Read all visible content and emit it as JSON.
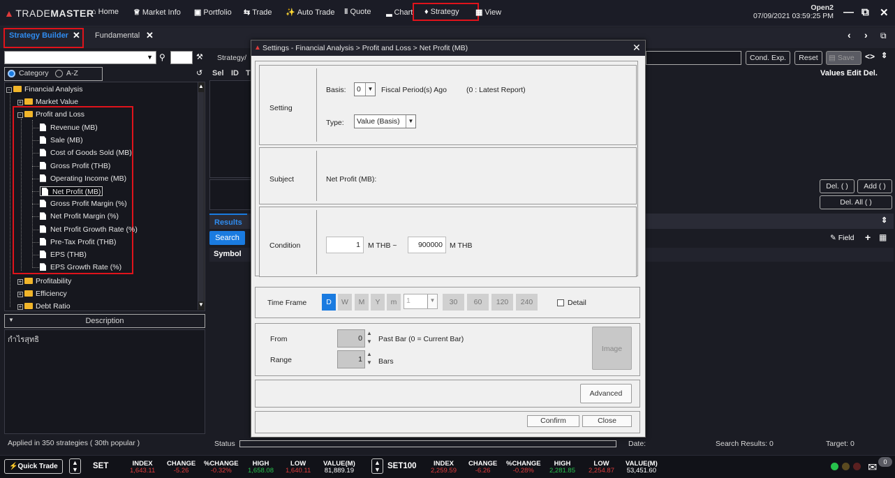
{
  "app": {
    "logo": "TRADEMASTER",
    "logo_brand": "TRADE",
    "logo_rest": "MASTER"
  },
  "menu": [
    {
      "label": "Home",
      "icon": "home-icon"
    },
    {
      "label": "Market Info",
      "icon": "bank-icon"
    },
    {
      "label": "Portfolio",
      "icon": "briefcase-icon"
    },
    {
      "label": "Trade",
      "icon": "trade-icon"
    },
    {
      "label": "Auto Trade",
      "icon": "auto-trade-icon"
    },
    {
      "label": "Quote",
      "icon": "quote-icon"
    },
    {
      "label": "Chart",
      "icon": "chart-icon"
    },
    {
      "label": "Strategy",
      "icon": "strategy-icon"
    },
    {
      "label": "View",
      "icon": "view-icon"
    }
  ],
  "account": {
    "name": "Open2",
    "datetime": "07/09/2021 03:59:25 PM"
  },
  "tabs": [
    {
      "label": "Strategy Builder",
      "active": true
    },
    {
      "label": "Fundamental",
      "active": false
    }
  ],
  "left": {
    "radio_category": "Category",
    "radio_az": "A-Z",
    "tree": {
      "financial_analysis": "Financial Analysis",
      "market_value": "Market Value",
      "profit_and_loss": "Profit and Loss",
      "pl_items": [
        "Revenue (MB)",
        "Sale (MB)",
        "Cost of Goods Sold (MB)",
        "Gross Profit (THB)",
        "Operating Income (MB)",
        "Net Profit (MB)",
        "Gross Profit Margin (%)",
        "Net Profit Margin (%)",
        "Net Profit Growth Rate (%)",
        "Pre-Tax Profit (THB)",
        "EPS (THB)",
        "EPS Growth Rate (%)"
      ],
      "selected_index": 5,
      "profitability": "Profitability",
      "efficiency": "Efficiency",
      "debt_ratio": "Debt Ratio"
    },
    "description_label": "Description",
    "description_text": "กำไรสุทธิ",
    "applied_text": "Applied in 350 strategies ( 30th popular )"
  },
  "main": {
    "strategy_label": "Strategy/",
    "cond_exp": "Cond. Exp.",
    "reset": "Reset",
    "save": "Save",
    "col_sel": "Sel",
    "col_id": "ID",
    "col_t": "T",
    "values_edit_del": "Values Edit  Del.",
    "del_paren": "Del. ( )",
    "add_paren": "Add ( )",
    "del_all": "Del. All ( )",
    "results": "Results",
    "search": "Search",
    "symbol": "Symbol",
    "field": "Field"
  },
  "status": {
    "status_label": "Status",
    "date_label": "Date:",
    "search_results": "Search Results:  0",
    "target": "Target:  0"
  },
  "dialog": {
    "title": "Settings - Financial Analysis > Profit and Loss > Net Profit (MB)",
    "setting_label": "Setting",
    "basis_label": "Basis:",
    "basis_value": "0",
    "fiscal_text": "Fiscal Period(s) Ago",
    "latest_text": "(0 : Latest Report)",
    "type_label": "Type:",
    "type_value": "Value (Basis)",
    "subject_label": "Subject",
    "subject_value": "Net Profit (MB):",
    "condition_label": "Condition",
    "cond_min": "1",
    "cond_unit1": "M THB ~",
    "cond_max": "900000",
    "cond_unit2": "M THB",
    "timeframe_label": "Time Frame",
    "tf_buttons": [
      "D",
      "W",
      "M",
      "Y",
      "m"
    ],
    "tf_combo": "1",
    "tf_minutes": [
      "30",
      "60",
      "120",
      "240"
    ],
    "detail_label": "Detail",
    "from_label": "From",
    "from_value": "0",
    "past_bar_text": "Past Bar (0 = Current Bar)",
    "range_label": "Range",
    "range_value": "1",
    "bars_text": "Bars",
    "image_label": "Image",
    "advanced": "Advanced",
    "confirm": "Confirm",
    "close": "Close"
  },
  "ticker": {
    "quick_trade": "Quick Trade",
    "set_name": "SET",
    "set100_name": "SET100",
    "headers": [
      "INDEX",
      "CHANGE",
      "%CHANGE",
      "HIGH",
      "LOW",
      "VALUE(M)"
    ],
    "set_values": [
      "1,643.11",
      "-5.26",
      "-0.32%",
      "1,658.08",
      "1,640.11",
      "81,889.19"
    ],
    "set100_values": [
      "2,259.59",
      "-6.26",
      "-0.28%",
      "2,281.85",
      "2,254.87",
      "53,451.60"
    ],
    "mail_count": "0"
  },
  "colors": {
    "highlight_red": "#e0131b",
    "accent_blue": "#1a7be0",
    "negative": "#e03b3b",
    "positive": "#27c24c"
  }
}
